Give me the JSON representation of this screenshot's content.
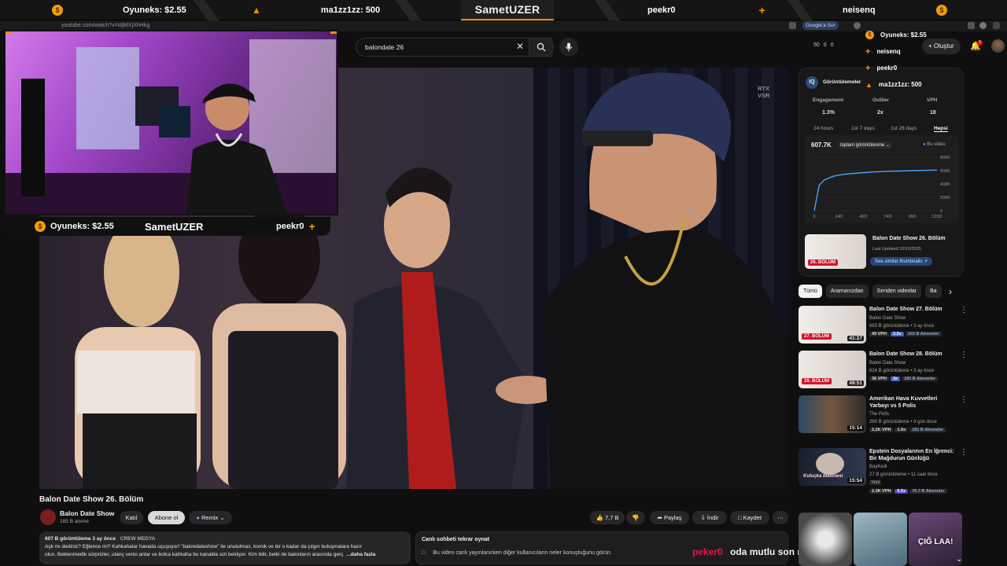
{
  "stream_overlay": {
    "top_slots": [
      {
        "icon": "coin",
        "label": "Oyuneks: $2.55"
      },
      {
        "icon": "flame",
        "label": "ma1zz1zz: 500"
      },
      {
        "icon": "plus",
        "label": "peekr0"
      },
      {
        "icon": "none",
        "label": "neisenq"
      }
    ],
    "streamer_name": "SametUZER",
    "cam_label_left": "Oyuneks: $2.55",
    "cam_label_right": "peekr0",
    "side_list": [
      {
        "icon": "coin",
        "label": "Oyuneks: $2.55"
      },
      {
        "icon": "plus",
        "label": "neisenq"
      },
      {
        "icon": "plus",
        "label": "peekr0"
      },
      {
        "icon": "flame",
        "label": "ma1zz1zz: 500"
      }
    ],
    "bottom_message_user": "peker0",
    "bottom_message_text": "oda mutlu son masajcısı"
  },
  "browser": {
    "url": "youtube.com/watch?v=tdjMXjXhHkg",
    "chip_label": "Google'a Sor"
  },
  "header": {
    "search_value": "balondate 26",
    "counters": [
      "50",
      "0",
      "0"
    ],
    "create_label": "Oluştur",
    "notif_count": "9"
  },
  "player": {
    "watermark": "RTX\nVSR"
  },
  "video": {
    "title": "Balon Date Show 26. Bölüm",
    "channel_name": "Balon Date Show",
    "subscribers": "185 B abone",
    "join_label": "Katıl",
    "subscribe_label": "Abone ol",
    "remix_label": "Remix",
    "likes": "7,7 B",
    "share_label": "Paylaş",
    "download_label": "İndir",
    "save_label": "Kaydet",
    "desc_meta": "607 B görüntüleme  3 ay önce",
    "desc_tag": "CREW MEDYA",
    "desc_line1": "Aşk mı dediniz? Eğlence mi? Kahkahalar havada uçuşuyor! \"balondateshow\" ile unutulmaz, komik ve bir o kadar da çılgın buluşmalara hazır",
    "desc_line2": "olun. Beklenmedik sürprizler, utanç verici anlar ve bolca kahkaha bu kanalda sizi bekliyor. Kim bilir, belki de balonların arasında gerç",
    "desc_more": "...daha fazla",
    "chat_title": "Canlı sohbeti tekrar oynat",
    "chat_text": "Bu video canlı yayınlanırken diğer kullanıcıların neler konuştuğunu görün."
  },
  "stats_panel": {
    "tab_label": "Görüntülemeler",
    "engagement_label": "Engagement",
    "engagement_value": "1.3%",
    "outlier_label": "Outlier",
    "outlier_value": "2x",
    "vph_label": "VPH",
    "vph_value": "18",
    "ranges": [
      "24 hours",
      "1st 7 days",
      "1st 28 days",
      "Hepsi"
    ],
    "graph_total": "607.7K",
    "graph_select": "toplam görüntülenme",
    "graph_legend": "Bu video",
    "y_ticks": [
      "800K",
      "600K",
      "400K",
      "200K",
      "0"
    ],
    "x_ticks": [
      "0",
      "24D",
      "49D",
      "74D",
      "99D",
      "123D"
    ],
    "card_title": "Balon Date Show 26. Bölüm",
    "card_updated": "Last Updated 10/10/2025",
    "card_button": "See similar thumbnails",
    "thumb_badge": "26. BÖLÜM"
  },
  "chart_data": {
    "type": "line",
    "series": [
      {
        "name": "Bu video",
        "x": [
          0,
          5,
          10,
          20,
          30,
          45,
          60,
          80,
          100,
          123
        ],
        "y": [
          0,
          380000,
          460000,
          520000,
          545000,
          565000,
          580000,
          592000,
          600000,
          607700
        ]
      }
    ],
    "xlabel": "",
    "ylabel": "",
    "ylim": [
      0,
      800000
    ],
    "xlim": [
      0,
      123
    ]
  },
  "filter_chips": [
    "Tümü",
    "Aramanızdan",
    "Seriden videolar",
    "Ba"
  ],
  "recommendations": [
    {
      "title": "Balon Date Show 27. Bölüm",
      "channel": "Balon Date Show",
      "meta": "663 B görüntüleme • 3 ay önce",
      "tags": [
        "49 VPH",
        "3.2x",
        "103 B Aboneler"
      ],
      "duration": "41:27",
      "badge": "27. BÖLÜM"
    },
    {
      "title": "Balon Date Show 28. Bölüm",
      "channel": "Balon Date Show",
      "meta": "624 B görüntüleme • 3 ay önce",
      "tags": [
        "36 VPH",
        "3x",
        "185 B Aboneler"
      ],
      "duration": "49:51",
      "badge": "28. BÖLÜM"
    },
    {
      "title": "Amerikan Hava Kuvvetleri Yarbayı vs 5 Polis",
      "channel": "The Polis",
      "meta": "290 B görüntüleme • 9 gün önce",
      "tags": [
        "2.2K VPH",
        "1.9x",
        "151 B Aboneler"
      ],
      "duration": "15:14",
      "badge": ""
    },
    {
      "title": "Epstein Dosyalarının En İğrenci: Bir Mağdurun Günlüğü",
      "channel": "BayKedi",
      "meta": "27 B görüntüleme • 11 saat önce",
      "tags": [
        "2.3K VPH",
        "6.5x",
        "76.7 B Aboneler"
      ],
      "duration": "15:54",
      "badge": "",
      "new_label": "Yeni",
      "thumb_text": "Kuluçka Makinesi"
    }
  ],
  "shorts": [
    {
      "caption": ""
    },
    {
      "caption": ""
    },
    {
      "caption": "ÇIĞ LAA!"
    }
  ]
}
